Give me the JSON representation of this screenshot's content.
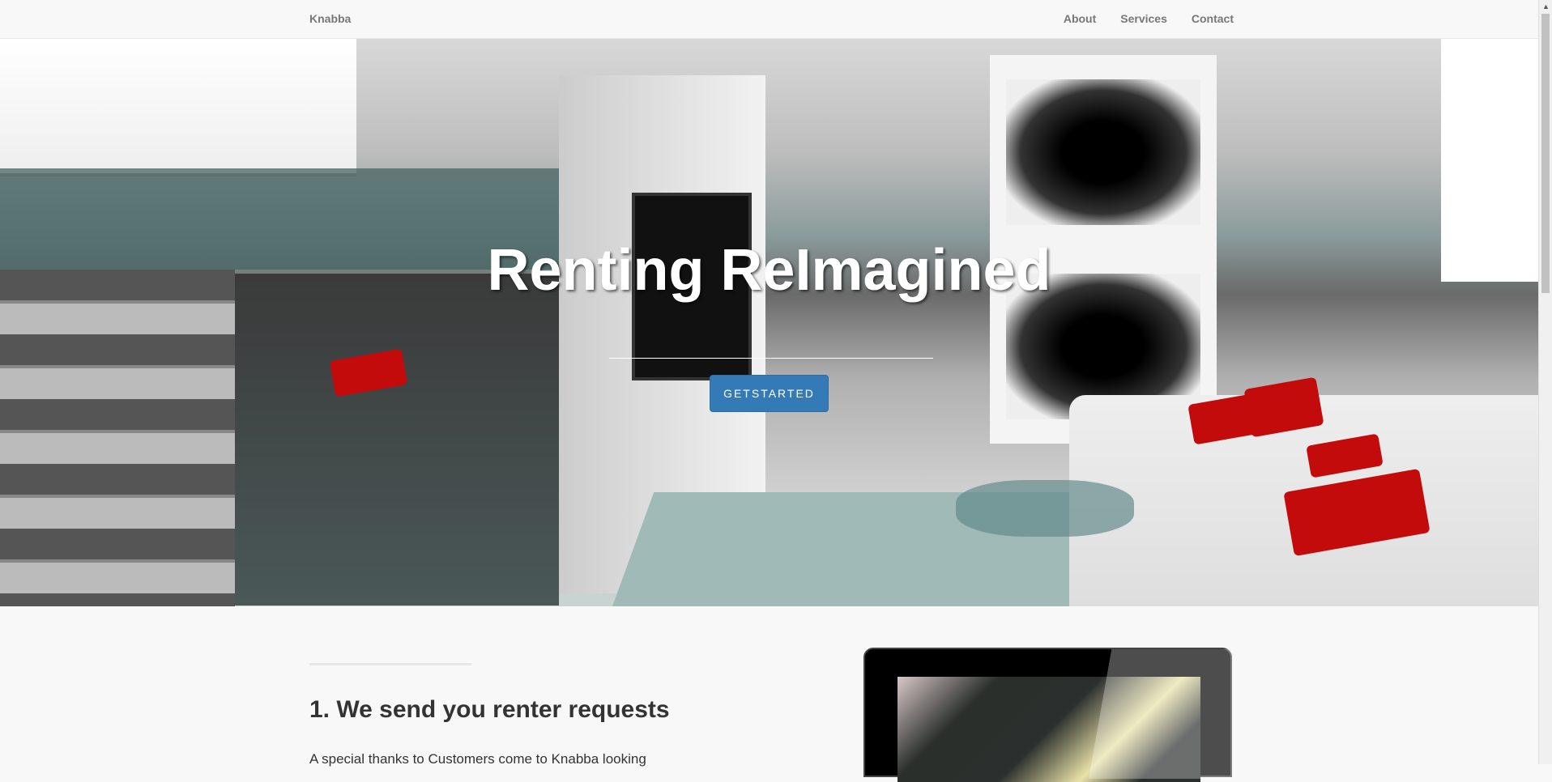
{
  "nav": {
    "brand": "Knabba",
    "links": [
      "About",
      "Services",
      "Contact"
    ]
  },
  "hero": {
    "title": "Renting ReImagined",
    "button": "GETSTARTED"
  },
  "section": {
    "heading": "1. We send you renter requests",
    "text": "A special thanks to Customers come to Knabba looking"
  }
}
